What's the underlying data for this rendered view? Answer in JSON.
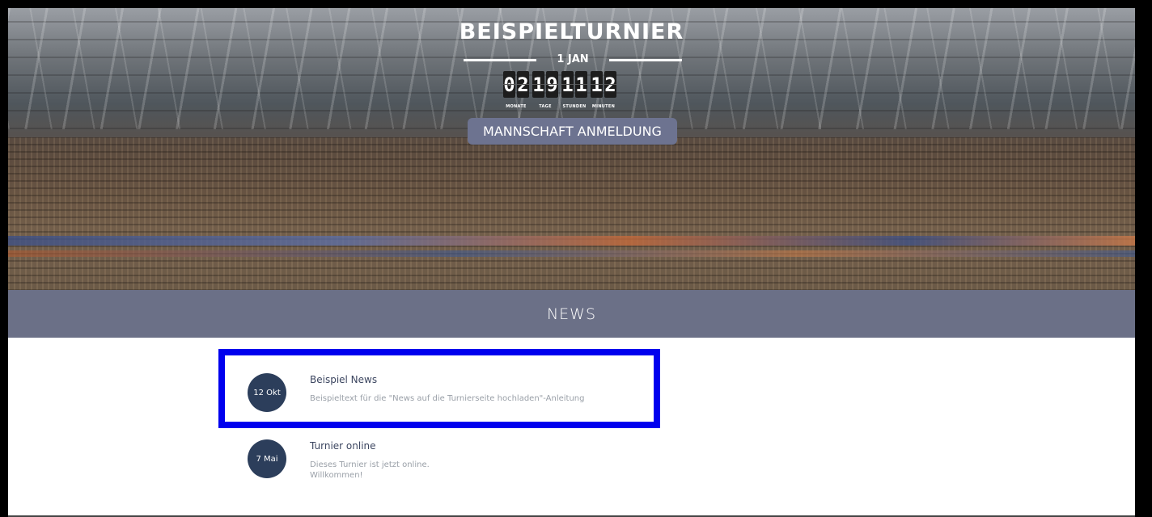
{
  "hero": {
    "title": "BEISPIELTURNIER",
    "date": "1 JAN",
    "countdown": [
      {
        "digits": [
          "0",
          "2"
        ],
        "label": "MONATE"
      },
      {
        "digits": [
          "1",
          "9"
        ],
        "label": "TAGE"
      },
      {
        "digits": [
          "1",
          "1"
        ],
        "label": "STUNDEN"
      },
      {
        "digits": [
          "1",
          "2"
        ],
        "label": "MINUTEN"
      }
    ],
    "register_label": "MANNSCHAFT ANMELDUNG"
  },
  "news": {
    "heading": "NEWS",
    "items": [
      {
        "date": "12 Okt",
        "title": "Beispiel News",
        "text": "Beispieltext für die \"News auf die Turnierseite hochladen\"-Anleitung",
        "highlight_color": "#0000ee"
      },
      {
        "date": "7 Mai",
        "title": "Turnier online",
        "text_lines": [
          "Dieses Turnier ist jetzt online.",
          "Willkommen!"
        ]
      }
    ]
  },
  "colors": {
    "news_bar": "#6b7087",
    "button": "#6d7390",
    "badge": "#2c3e5b"
  }
}
